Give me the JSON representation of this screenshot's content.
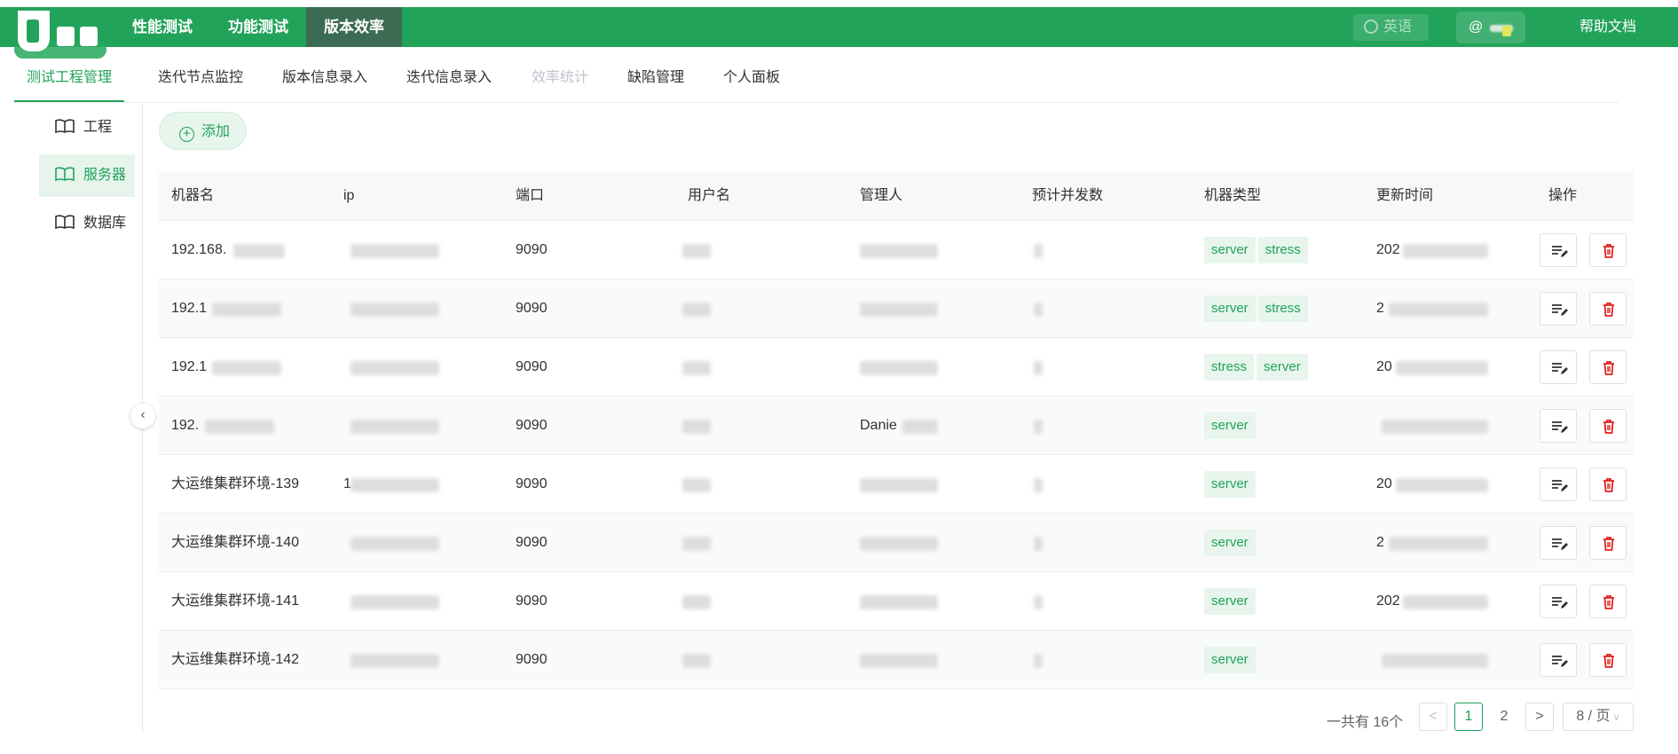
{
  "topnav": {
    "items": [
      {
        "label": "性能测试"
      },
      {
        "label": "功能测试"
      },
      {
        "label": "版本效率"
      }
    ],
    "language_label": "英语",
    "user_label": "@",
    "help_label": "帮助文档"
  },
  "subtabs": [
    {
      "label": "测试工程管理"
    },
    {
      "label": "迭代节点监控"
    },
    {
      "label": "版本信息录入"
    },
    {
      "label": "迭代信息录入"
    },
    {
      "label": "效率统计"
    },
    {
      "label": "缺陷管理"
    },
    {
      "label": "个人面板"
    }
  ],
  "sidebar": {
    "items": [
      {
        "label": "工程"
      },
      {
        "label": "服务器"
      },
      {
        "label": "数据库"
      }
    ]
  },
  "add_button_label": "添加",
  "table": {
    "headers": [
      "机器名",
      "ip",
      "端口",
      "用户名",
      "管理人",
      "预计并发数",
      "机器类型",
      "更新时间",
      "操作"
    ],
    "rows": [
      {
        "name": "192.168.",
        "ip": "",
        "port": "9090",
        "manager": "",
        "tags": [
          "server",
          "stress"
        ],
        "updated": "202"
      },
      {
        "name": "192.1",
        "ip": "",
        "port": "9090",
        "manager": "",
        "tags": [
          "server",
          "stress"
        ],
        "updated": "2"
      },
      {
        "name": "192.1",
        "ip": "",
        "port": "9090",
        "manager": "",
        "tags": [
          "stress",
          "server"
        ],
        "updated": "20"
      },
      {
        "name": "192.",
        "ip": "",
        "port": "9090",
        "manager": "Danie",
        "tags": [
          "server"
        ],
        "updated": ""
      },
      {
        "name": "大运维集群环境-139",
        "ip": "1",
        "port": "9090",
        "manager": "",
        "tags": [
          "server"
        ],
        "updated": "20"
      },
      {
        "name": "大运维集群环境-140",
        "ip": "",
        "port": "9090",
        "manager": "",
        "tags": [
          "server"
        ],
        "updated": "2"
      },
      {
        "name": "大运维集群环境-141",
        "ip": "",
        "port": "9090",
        "manager": "",
        "tags": [
          "server"
        ],
        "updated": "202"
      },
      {
        "name": "大运维集群环境-142",
        "ip": "",
        "port": "9090",
        "manager": "",
        "tags": [
          "server"
        ],
        "updated": ""
      }
    ]
  },
  "pagination": {
    "total_label": "一共有 16个",
    "prev": "<",
    "pages": [
      "1",
      "2"
    ],
    "current": "1",
    "next": ">",
    "page_size": "8 / 页"
  },
  "colors": {
    "brand": "#22a35a",
    "active_nav": "#3c6b54",
    "danger": "#e02020"
  }
}
